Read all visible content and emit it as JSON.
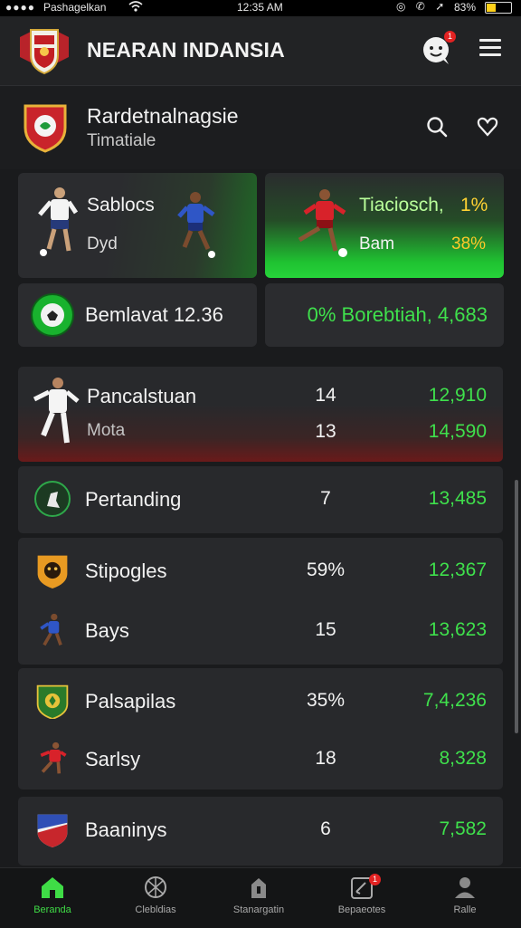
{
  "status_bar": {
    "carrier": "Pashagelkan",
    "time": "12:35 AM",
    "battery": "83%"
  },
  "header": {
    "app_title": "NEARAN INDANSIA",
    "chat_badge": "1"
  },
  "team": {
    "name": "Rardetnalnagsie",
    "subtitle": "Timatiale"
  },
  "cards": {
    "match_left": {
      "title": "Sablocs",
      "subtitle": "Dyd"
    },
    "match_right": {
      "title": "Tiaciosch,",
      "title_pct": "1%",
      "subtitle": "Bam",
      "subtitle_pct": "38%"
    },
    "stat_left": "Bemlavat 12.36",
    "stat_right": "0% Borebtiah, 4,683"
  },
  "rows": [
    {
      "name": "Pancalstuan",
      "num": "14",
      "value": "12,910"
    },
    {
      "name": "Mota",
      "num": "13",
      "value": "14,590"
    },
    {
      "name": "Pertanding",
      "num": "7",
      "value": "13,485"
    },
    {
      "name": "Stipogles",
      "num": "59%",
      "value": "12,367"
    },
    {
      "name": "Bays",
      "num": "15",
      "value": "13,623"
    },
    {
      "name": "Palsapilas",
      "num": "35%",
      "value": "7,4,236"
    },
    {
      "name": "Sarlsy",
      "num": "18",
      "value": "8,328"
    },
    {
      "name": "Baaninys",
      "num": "6",
      "value": "7,582"
    }
  ],
  "bottom_nav": [
    {
      "label": "Beranda",
      "icon": "home-icon"
    },
    {
      "label": "Clebldias",
      "icon": "ball-icon"
    },
    {
      "label": "Stanargatin",
      "icon": "building-icon"
    },
    {
      "label": "Bepaeotes",
      "icon": "boot-icon",
      "badge": "1"
    },
    {
      "label": "Ralle",
      "icon": "profile-icon"
    }
  ],
  "colors": {
    "accent_green": "#3fe04c",
    "badge_red": "#e32222",
    "highlight_yellow": "#ffd233"
  }
}
